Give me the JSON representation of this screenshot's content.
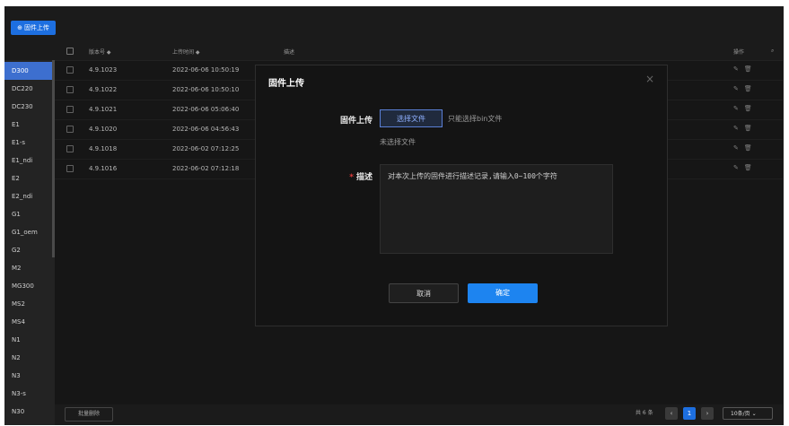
{
  "toolbar": {
    "upload_label": "固件上传"
  },
  "table": {
    "headers": {
      "version": "版本号 ◆",
      "upload_time": "上传时间 ◆",
      "description": "描述",
      "actions": "操作"
    },
    "rows": [
      {
        "version": "4.9.1023",
        "time": "2022-06-06 10:50:19"
      },
      {
        "version": "4.9.1022",
        "time": "2022-06-06 10:50:10"
      },
      {
        "version": "4.9.1021",
        "time": "2022-06-06 05:06:40"
      },
      {
        "version": "4.9.1020",
        "time": "2022-06-06 04:56:43"
      },
      {
        "version": "4.9.1018",
        "time": "2022-06-02 07:12:25"
      },
      {
        "version": "4.9.1016",
        "time": "2022-06-02 07:12:18"
      }
    ]
  },
  "sidebar": {
    "items": [
      {
        "label": "D300"
      },
      {
        "label": "DC220"
      },
      {
        "label": "DC230"
      },
      {
        "label": "E1"
      },
      {
        "label": "E1-s"
      },
      {
        "label": "E1_ndi"
      },
      {
        "label": "E2"
      },
      {
        "label": "E2_ndi"
      },
      {
        "label": "G1"
      },
      {
        "label": "G1_oem"
      },
      {
        "label": "G2"
      },
      {
        "label": "M2"
      },
      {
        "label": "MG300"
      },
      {
        "label": "MS2"
      },
      {
        "label": "MS4"
      },
      {
        "label": "N1"
      },
      {
        "label": "N2"
      },
      {
        "label": "N3"
      },
      {
        "label": "N3-s"
      },
      {
        "label": "N30"
      }
    ]
  },
  "footer": {
    "batch_delete": "批量删除",
    "total": "共 6 条",
    "current_page": "1",
    "page_size": "10条/页"
  },
  "dialog": {
    "title": "固件上传",
    "file_label": "固件上传",
    "choose_file": "选择文件",
    "file_hint": "只能选择bin文件",
    "no_file": "未选择文件",
    "desc_label": "描述",
    "desc_placeholder": "对本次上传的固件进行描述记录,请输入0~100个字符",
    "cancel": "取消",
    "confirm": "确定"
  },
  "colors": {
    "accent": "#1d84f0",
    "active_sidebar": "#3d6fcf",
    "required": "#e03b3b"
  }
}
